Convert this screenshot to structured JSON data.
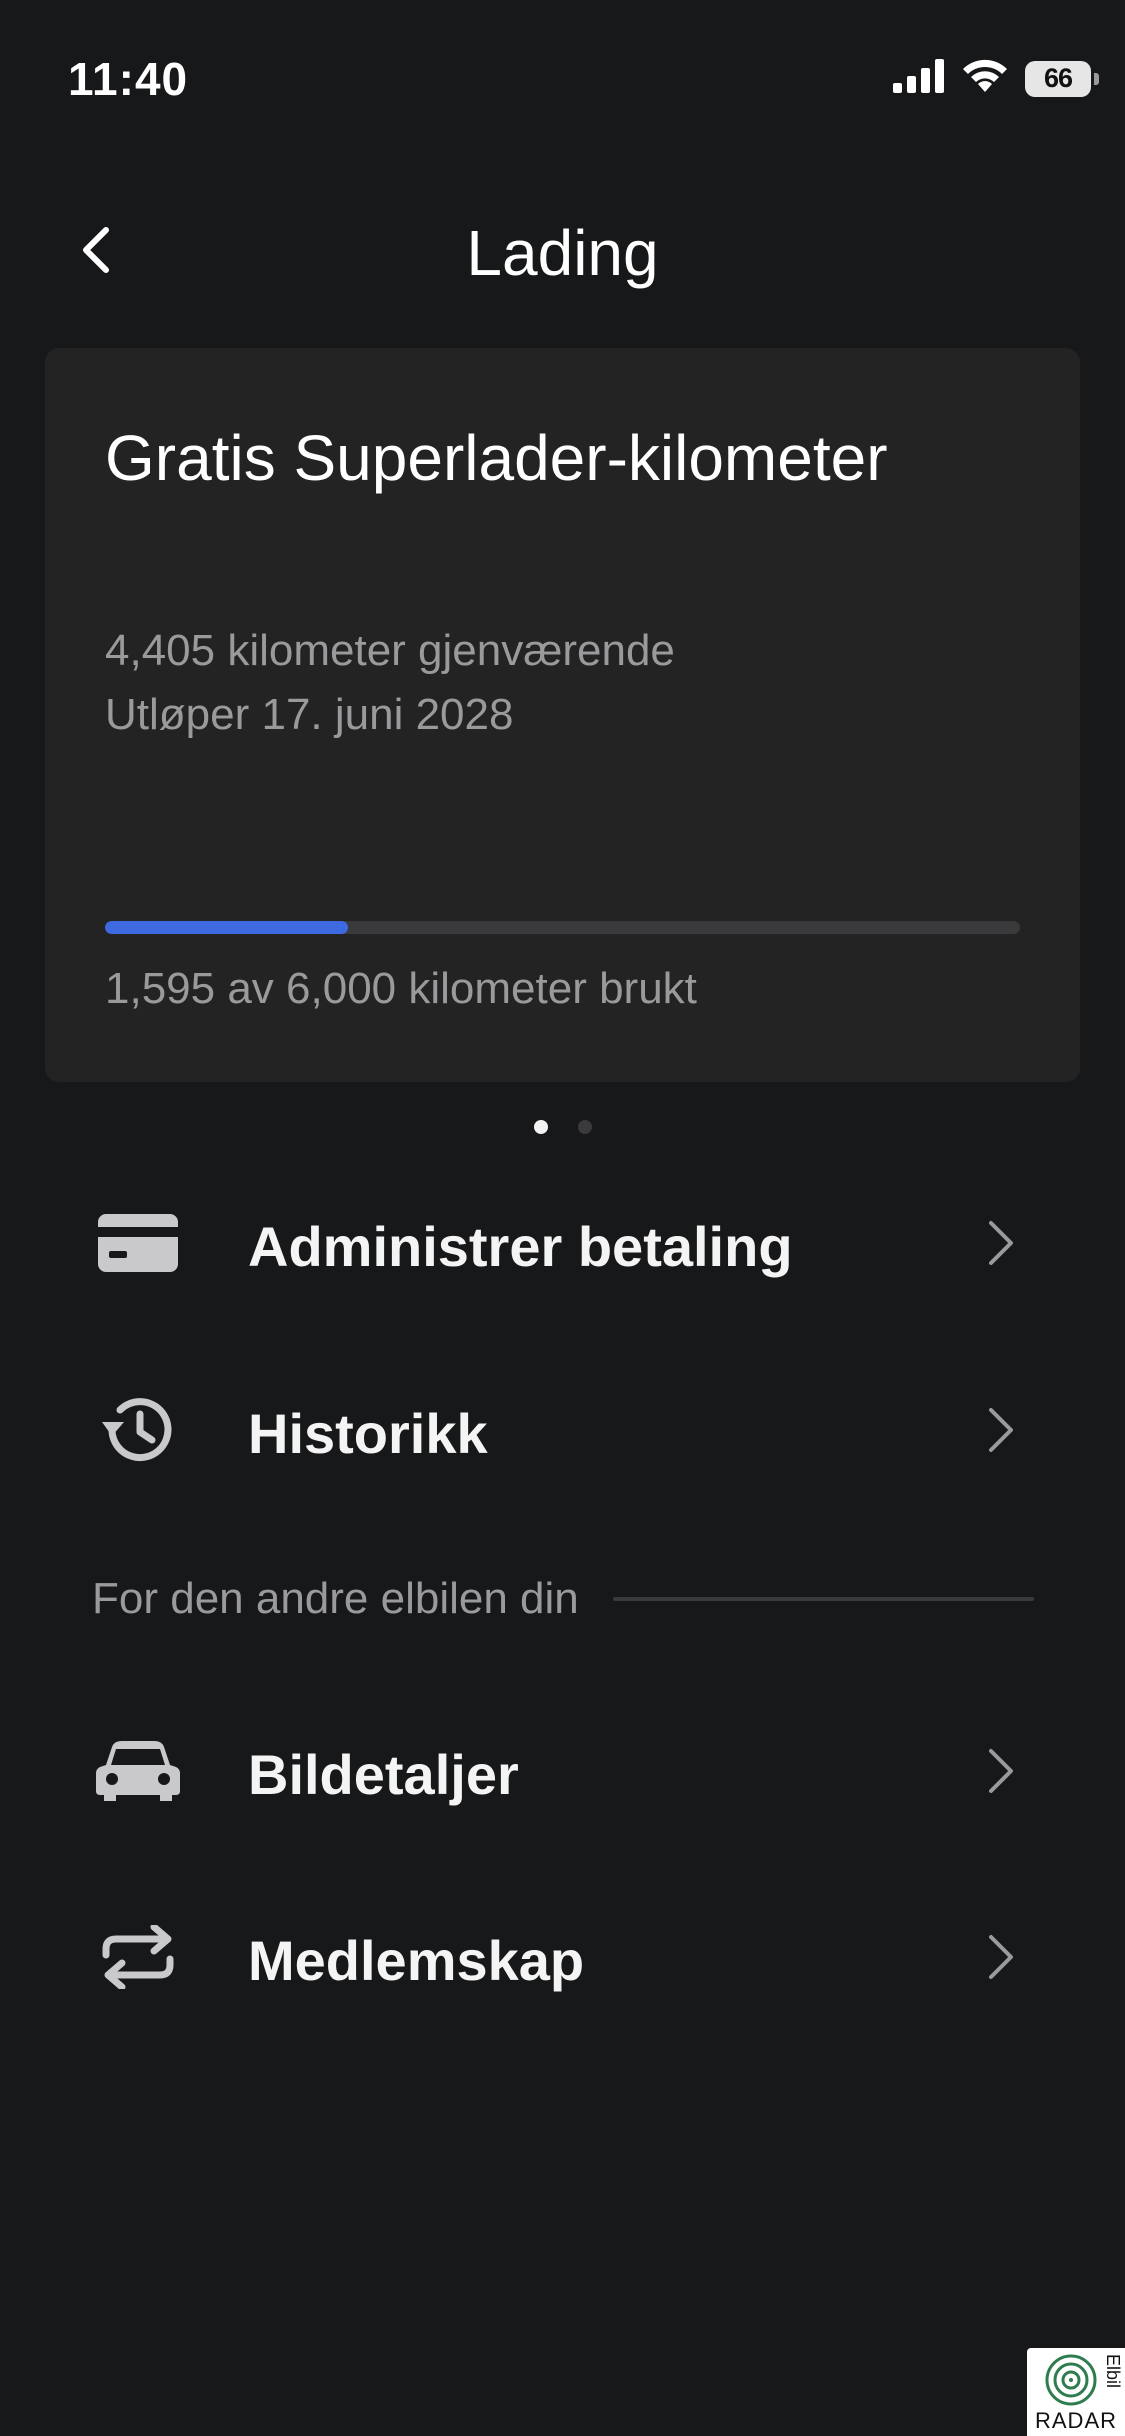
{
  "status_bar": {
    "time": "11:40",
    "battery_level": "66",
    "icons": [
      "cellular-signal-icon",
      "wifi-icon",
      "battery-icon"
    ]
  },
  "header": {
    "title": "Lading",
    "back_icon": "chevron-left-icon"
  },
  "card": {
    "title": "Gratis Superlader-kilometer",
    "remaining": "4,405 kilometer gjenværende",
    "expiry": "Utløper 17. juni 2028",
    "used_fraction": 0.266,
    "usage_label": "1,595 av 6,000 kilometer brukt",
    "accent_color": "#3e6ae1"
  },
  "pager": {
    "count": 2,
    "active_index": 0
  },
  "menu": {
    "payment": {
      "label": "Administrer betaling",
      "icon": "credit-card-icon"
    },
    "history": {
      "label": "Historikk",
      "icon": "history-clock-icon"
    },
    "section_label": "For den andre elbilen din",
    "car_details": {
      "label": "Bildetaljer",
      "icon": "car-icon"
    },
    "membership": {
      "label": "Medlemskap",
      "icon": "repeat-arrows-icon"
    }
  },
  "watermark": {
    "text": "RADAR",
    "side_text": "Elbil"
  }
}
